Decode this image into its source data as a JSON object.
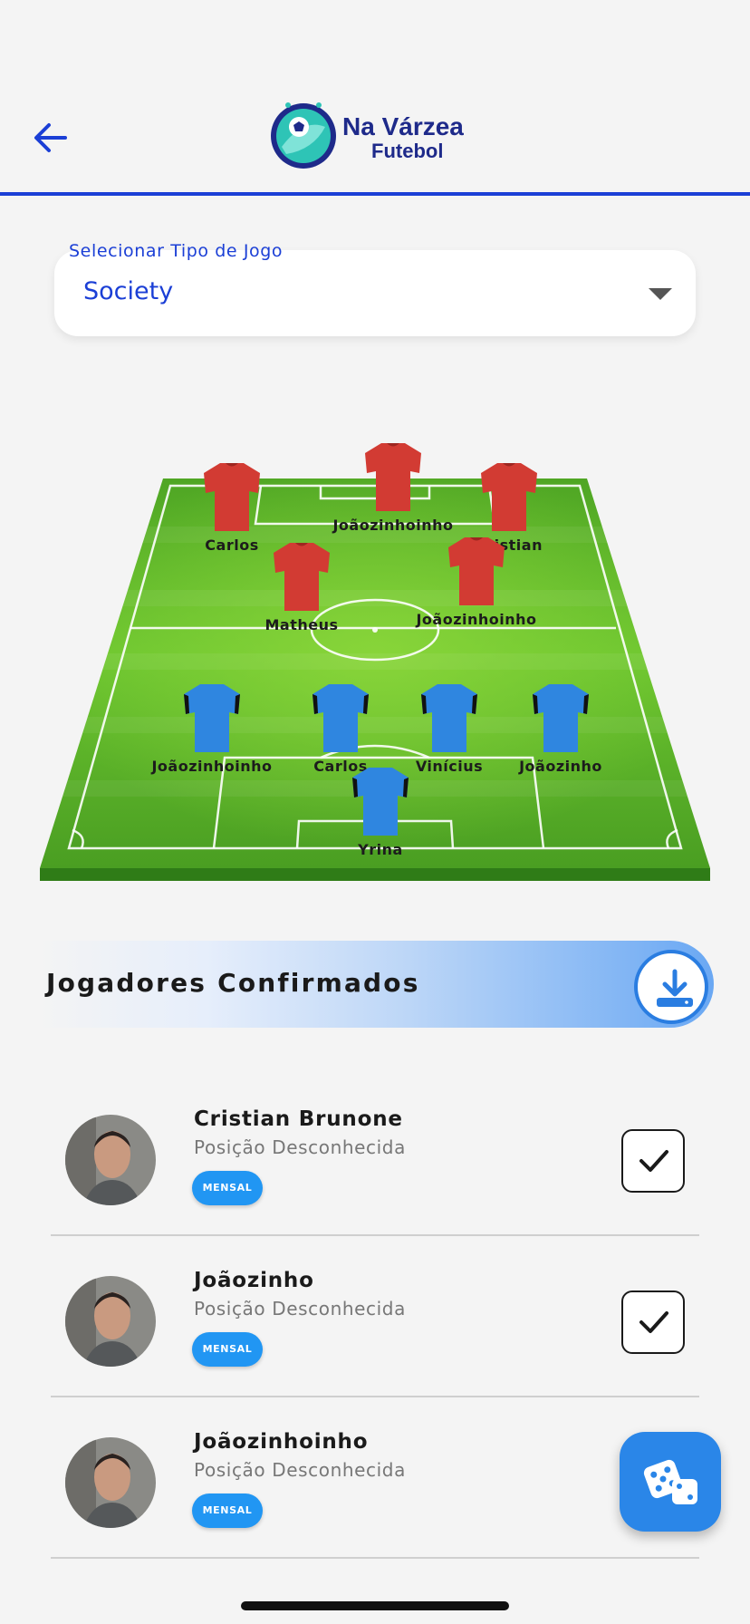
{
  "header": {
    "logo_title": "Na Várzea",
    "logo_subtitle": "Futebol"
  },
  "game_type": {
    "label": "Selecionar Tipo de Jogo",
    "value": "Society"
  },
  "field": {
    "red_team": [
      {
        "name": "Joãozinhoinho"
      },
      {
        "name": "Carlos"
      },
      {
        "name": "Cristian"
      },
      {
        "name": "Matheus"
      },
      {
        "name": "Joãozinhoinho"
      }
    ],
    "blue_team": [
      {
        "name": "Joãozinhoinho"
      },
      {
        "name": "Carlos"
      },
      {
        "name": "Vinícius"
      },
      {
        "name": "Joãozinho"
      },
      {
        "name": "Yrina"
      }
    ]
  },
  "confirmed": {
    "title": "Jogadores Confirmados",
    "players": [
      {
        "name": "Cristian Brunone",
        "position": "Posição Desconhecida",
        "badge": "MENSAL",
        "checked": true
      },
      {
        "name": "Joãozinho",
        "position": "Posição Desconhecida",
        "badge": "MENSAL",
        "checked": true
      },
      {
        "name": "Joãozinhoinho",
        "position": "Posição Desconhecida",
        "badge": "MENSAL",
        "checked": false
      }
    ]
  },
  "colors": {
    "accent": "#1b3fd6",
    "badge": "#2196f3",
    "red_shirt": "#d23b33",
    "blue_shirt": "#2f86e0",
    "pitch": "#5cb82e"
  },
  "icons": {
    "back": "arrow-left-icon",
    "dropdown": "caret-down-icon",
    "download": "download-icon",
    "check": "check-icon",
    "fab": "dice-icon"
  }
}
